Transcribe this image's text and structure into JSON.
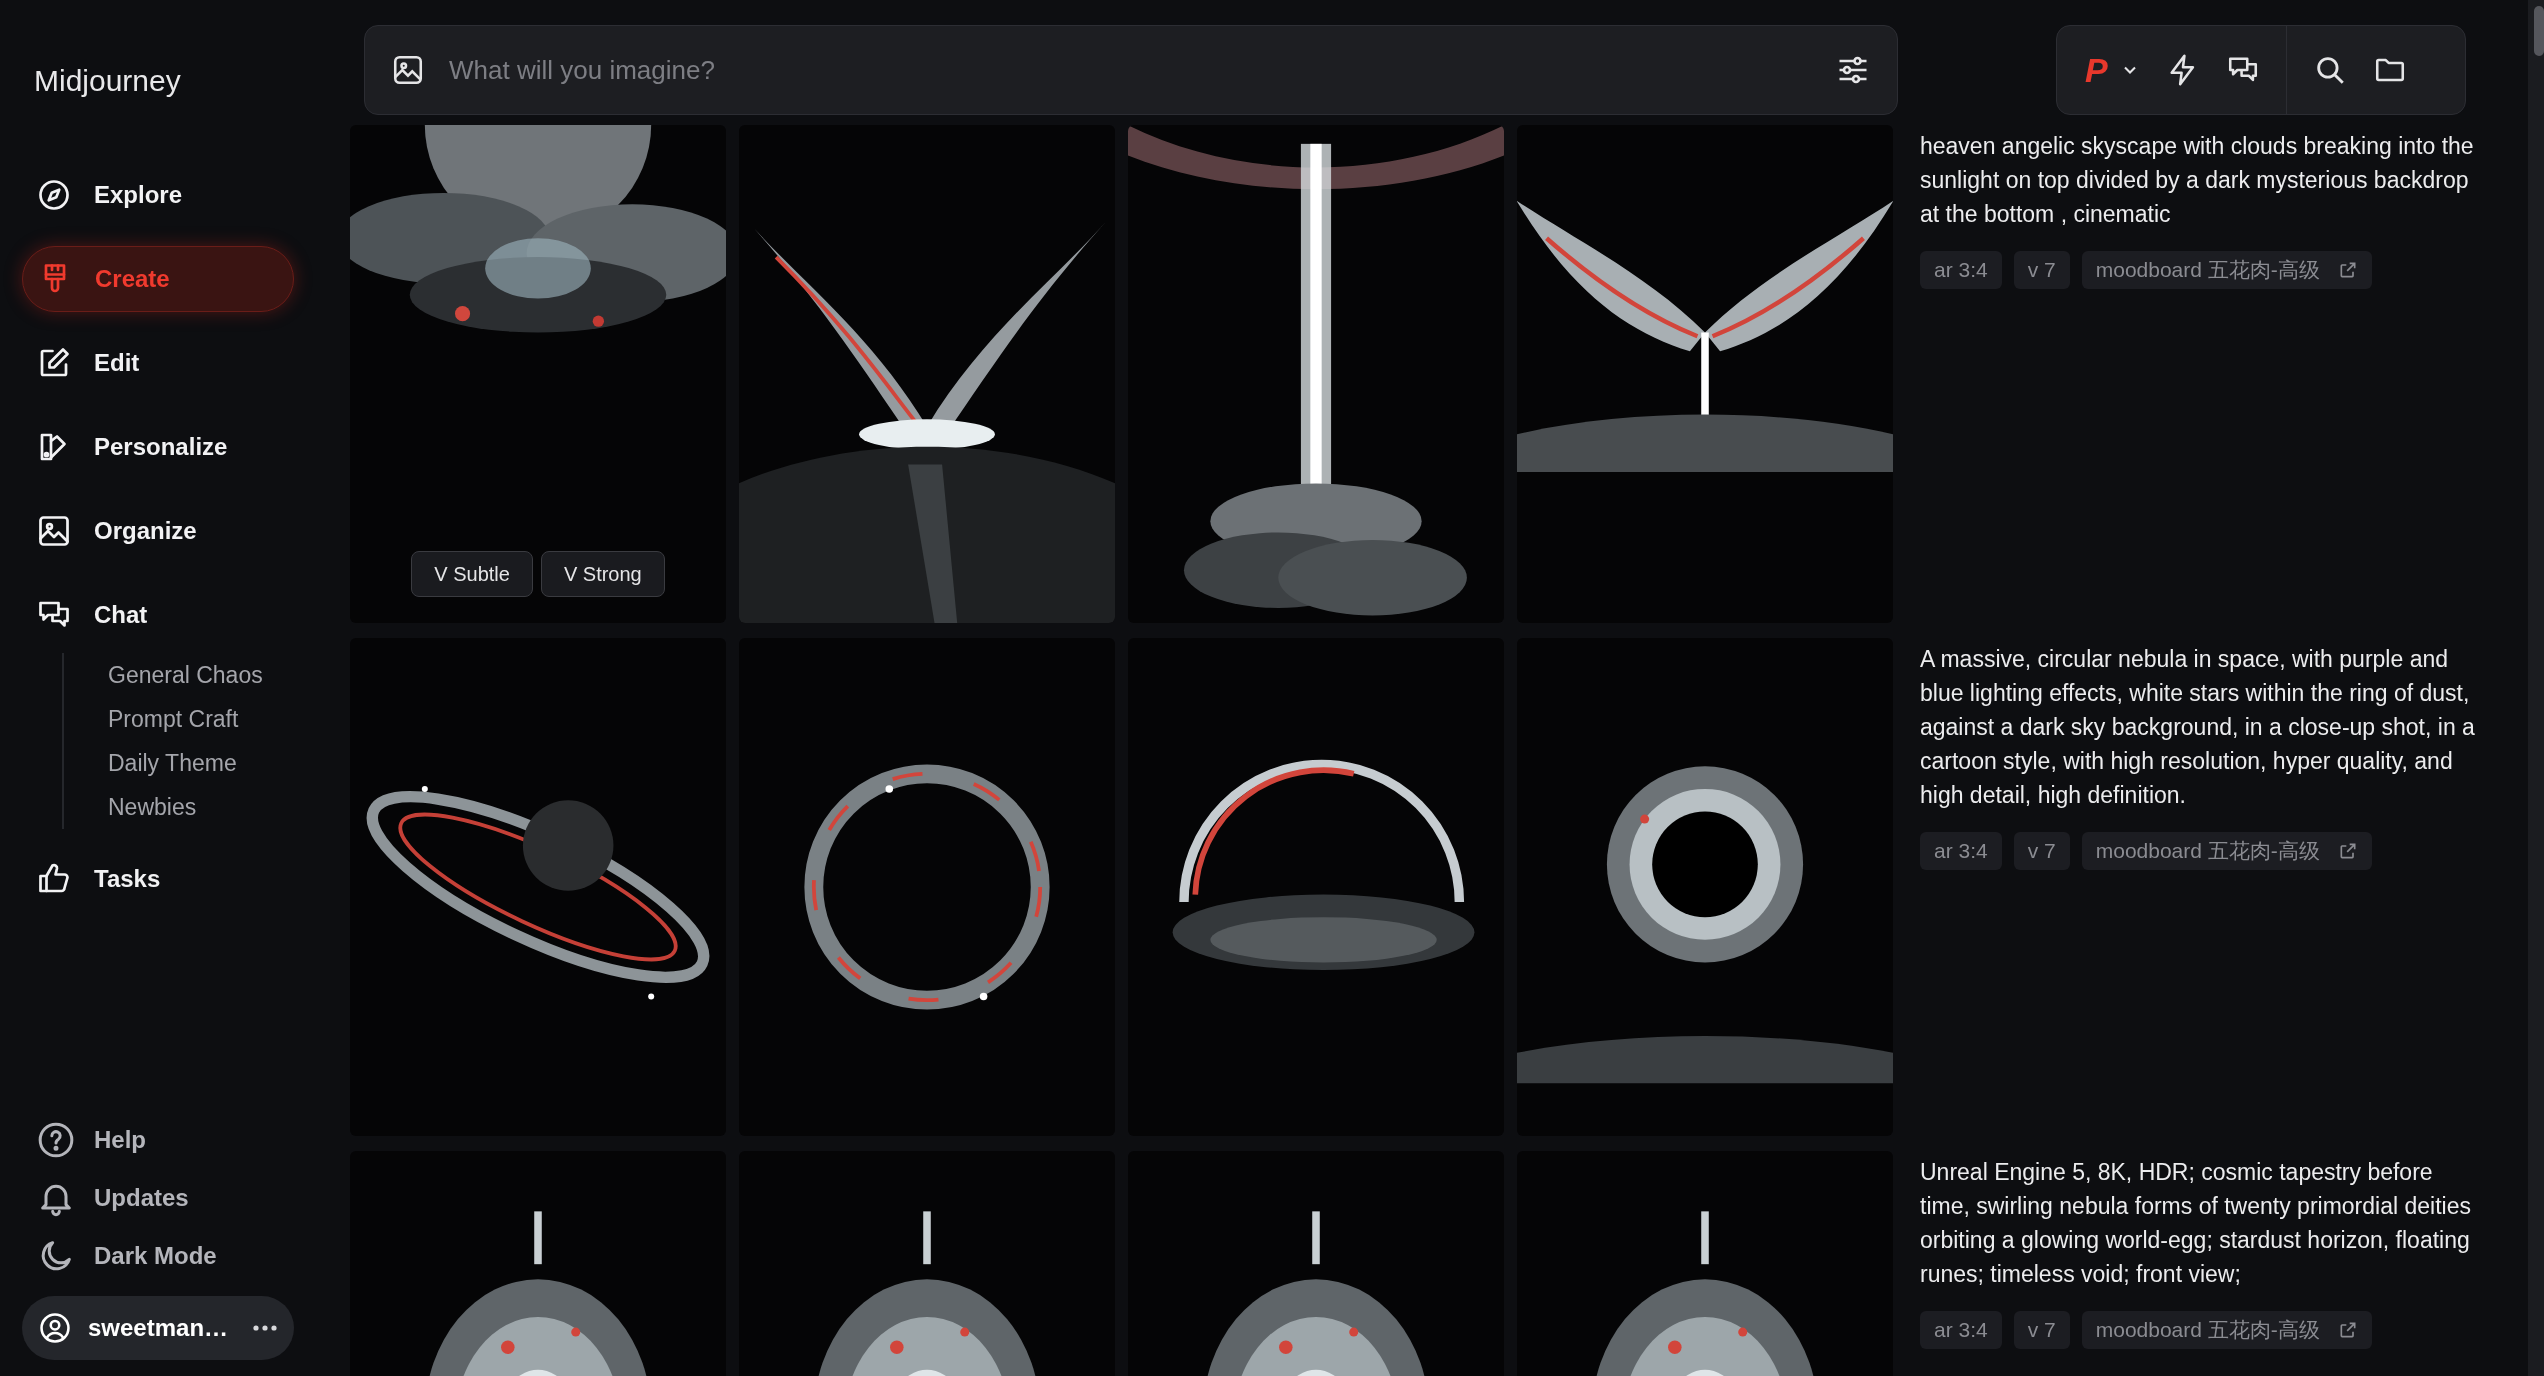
{
  "sidebar": {
    "logo": "Midjourney",
    "nav": [
      {
        "label": "Explore",
        "selected": false
      },
      {
        "label": "Create",
        "selected": true
      },
      {
        "label": "Edit",
        "selected": false
      },
      {
        "label": "Personalize",
        "selected": false
      },
      {
        "label": "Organize",
        "selected": false
      },
      {
        "label": "Chat",
        "selected": false,
        "children": [
          {
            "label": "General Chaos",
            "selected": false
          },
          {
            "label": "Prompt Craft",
            "selected": false
          },
          {
            "label": "Daily Theme",
            "selected": false
          },
          {
            "label": "Newbies",
            "selected": false
          }
        ]
      },
      {
        "label": "Tasks",
        "selected": false
      }
    ],
    "footer": [
      {
        "label": "Help"
      },
      {
        "label": "Updates"
      },
      {
        "label": "Dark Mode"
      }
    ],
    "user": {
      "name": "sweetman…"
    }
  },
  "prompt_bar": {
    "placeholder": "What will you imagine?"
  },
  "toolbar": {
    "mode": "P"
  },
  "rows": [
    {
      "images": [
        {
          "kind": "picture",
          "buttons": [
            "V Subtle",
            "V Strong"
          ]
        },
        {
          "kind": "picture"
        },
        {
          "kind": "picture"
        },
        {
          "kind": "picture"
        }
      ],
      "prompt": "heaven angelic skyscape with clouds breaking into the sunlight on top divided by a dark mysterious backdrop at the bottom , cinematic",
      "tags": [
        {
          "label": "ar 3:4",
          "kind": "param"
        },
        {
          "label": "v 7",
          "kind": "param"
        },
        {
          "label": "moodboard 五花肉-高级",
          "kind": "link"
        }
      ]
    },
    {
      "images": [
        {
          "kind": "picture"
        },
        {
          "kind": "picture"
        },
        {
          "kind": "picture"
        },
        {
          "kind": "picture"
        }
      ],
      "prompt": "A massive, circular nebula in space, with purple and blue lighting effects, white stars within the ring of dust, against a dark sky background, in a close-up shot, in a cartoon style, with high resolution, hyper quality, and high detail, high definition.",
      "tags": [
        {
          "label": "ar 3:4",
          "kind": "param"
        },
        {
          "label": "v 7",
          "kind": "param"
        },
        {
          "label": "moodboard 五花肉-高级",
          "kind": "link"
        }
      ]
    },
    {
      "images": [
        {
          "kind": "picture"
        },
        {
          "kind": "picture"
        },
        {
          "kind": "picture"
        },
        {
          "kind": "picture"
        }
      ],
      "prompt": "Unreal Engine 5, 8K, HDR; cosmic tapestry before time, swirling nebula forms of twenty primordial deities orbiting a glowing world-egg; stardust horizon, floating runes; timeless void; front view;",
      "tags": [
        {
          "label": "ar 3:4",
          "kind": "param"
        },
        {
          "label": "v 7",
          "kind": "param"
        },
        {
          "label": "moodboard 五花肉-高级",
          "kind": "link"
        }
      ]
    }
  ]
}
